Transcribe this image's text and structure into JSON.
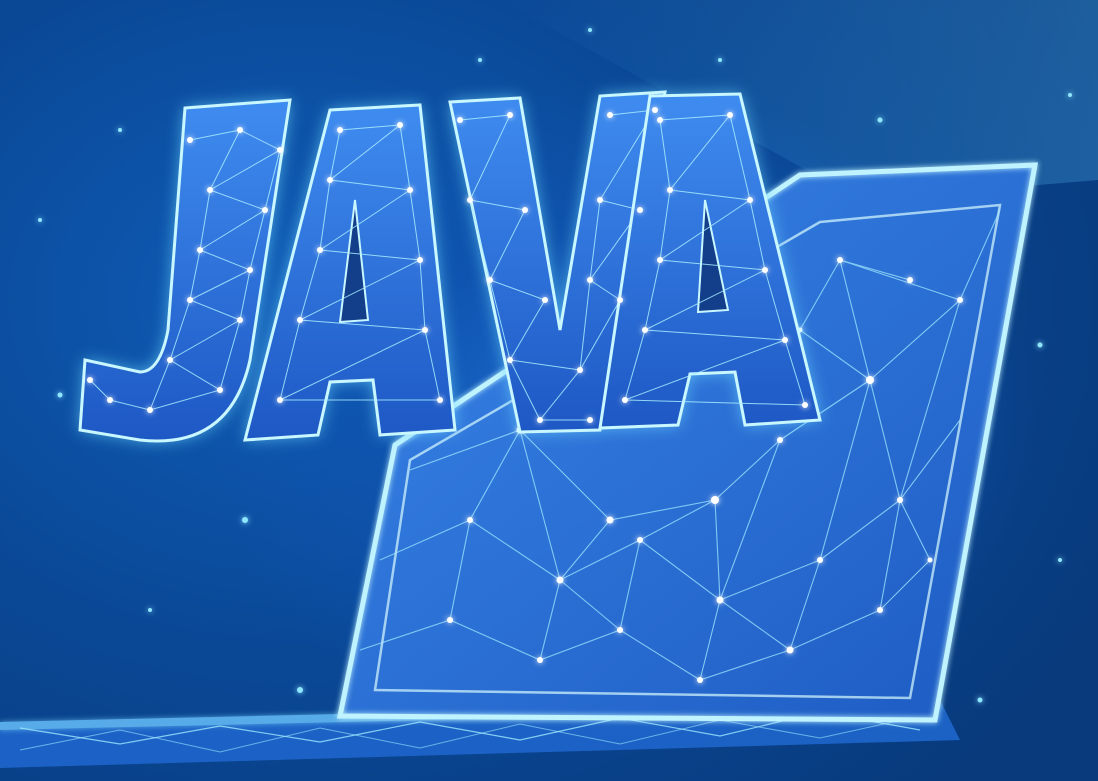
{
  "image": {
    "word": "JAVA",
    "colors": {
      "background_dark": "#083a7c",
      "background_mid": "#0f5db8",
      "glow": "#7fe6ff",
      "wire": "#9fe8ff",
      "node": "#ffffff",
      "letter_fill": "#2a6fd8",
      "letter_side": "#123e8a",
      "screen": "#2e74d8"
    }
  }
}
